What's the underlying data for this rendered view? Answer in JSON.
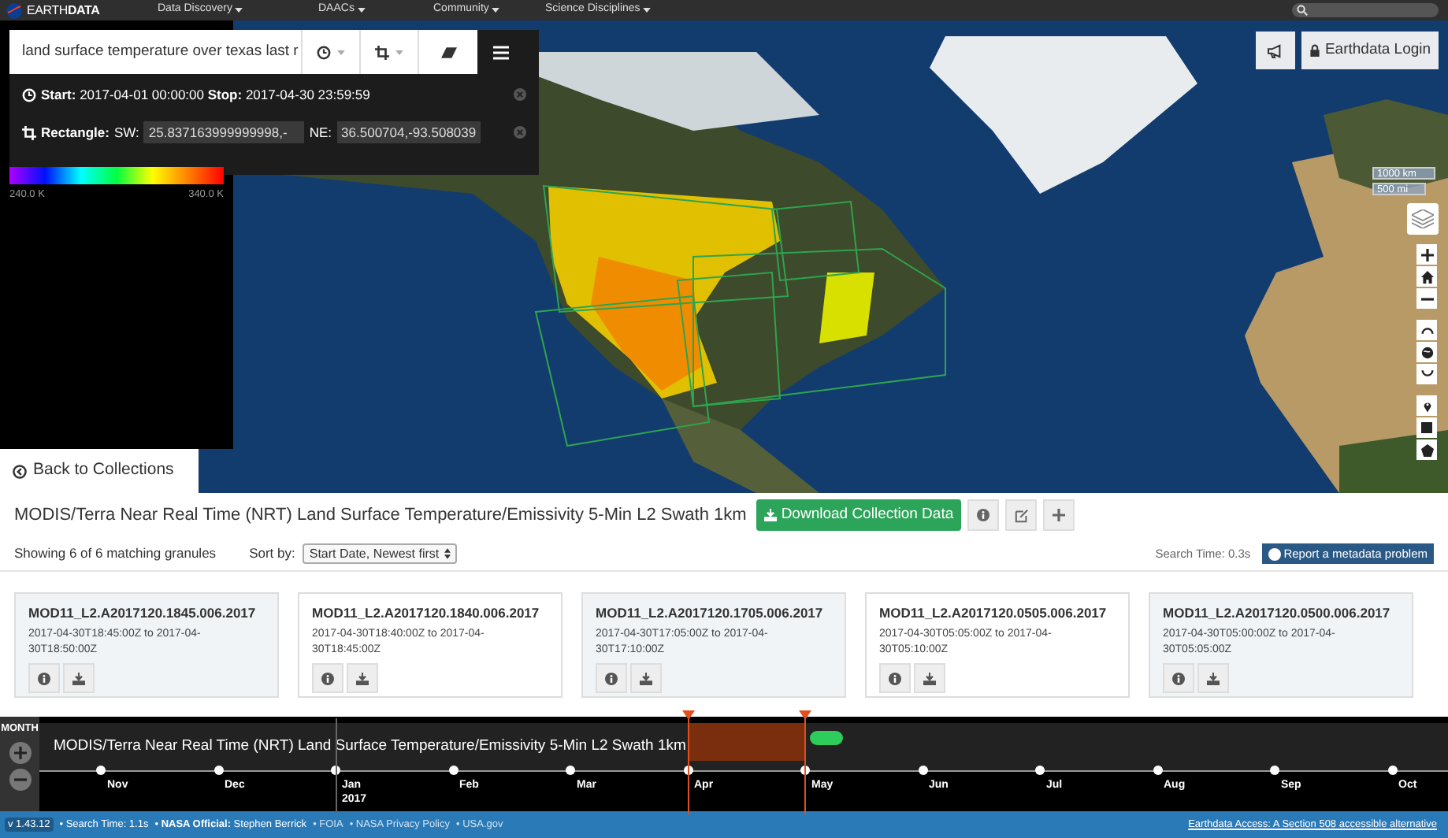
{
  "header": {
    "logo": "EARTH**DATA**",
    "menus": [
      "Data Discovery",
      "DAACs",
      "Community",
      "Science Disciplines"
    ]
  },
  "search_panel": {
    "query": "land surface temperature over texas last r",
    "temporal": "**Start:** 2017-04-01 00:00:00 **Stop:** 2017-04-30 23:59:59",
    "spatial_label": "Rectangle:",
    "sw_label": "SW:",
    "sw": "25.837163999999998,-",
    "ne_label": "NE:",
    "ne": "36.500704,-93.508039"
  },
  "legend": {
    "min": "240.0 K",
    "max": "340.0 K"
  },
  "map_controls": {
    "login": "Earthdata Login",
    "scale": [
      "1000 km",
      "500 mi"
    ]
  },
  "back_button": "Back to Collections",
  "collection": {
    "title": "MODIS/Terra Near Real Time (NRT) Land Surface Temperature/Emissivity 5-Min L2 Swath 1km",
    "download": "Download Collection Data",
    "count": "Showing 6 of 6 matching granules",
    "sort_label": "Sort by:",
    "sort_value": "Start Date, Newest first",
    "search_time": "Search Time: 0.3s",
    "report": "Report a metadata problem"
  },
  "granules": [
    {
      "name": "MOD11_L2.A2017120.1845.006.2017",
      "time": "2017-04-30T18:45:00Z to 2017-04-30T18:50:00Z"
    },
    {
      "name": "MOD11_L2.A2017120.1840.006.2017",
      "time": "2017-04-30T18:40:00Z to 2017-04-30T18:45:00Z"
    },
    {
      "name": "MOD11_L2.A2017120.1705.006.2017",
      "time": "2017-04-30T17:05:00Z to 2017-04-30T17:10:00Z"
    },
    {
      "name": "MOD11_L2.A2017120.0505.006.2017",
      "time": "2017-04-30T05:05:00Z to 2017-04-30T05:10:00Z"
    },
    {
      "name": "MOD11_L2.A2017120.0500.006.2017",
      "time": "2017-04-30T05:00:00Z to 2017-04-30T05:05:00Z"
    }
  ],
  "timeline": {
    "zoom_label": "MONTH",
    "track": "MODIS/Terra Near Real Time (NRT) Land Surface Temperature/Emissivity 5-Min L2 Swath 1km",
    "months": [
      {
        "label": "Nov",
        "marker": false
      },
      {
        "label": "Dec",
        "marker": false
      },
      {
        "label": "Jan",
        "year": "2017",
        "marker": false
      },
      {
        "label": "Feb",
        "marker": false
      },
      {
        "label": "Mar",
        "marker": false
      },
      {
        "label": "Apr",
        "marker": true
      },
      {
        "label": "May",
        "marker": true
      },
      {
        "label": "Jun",
        "marker": false
      },
      {
        "label": "Jul",
        "marker": false
      },
      {
        "label": "Aug",
        "marker": false
      },
      {
        "label": "Sep",
        "marker": false
      },
      {
        "label": "Oct",
        "marker": false
      }
    ]
  },
  "footer": {
    "version": "v 1.43.12",
    "items": [
      "• Search Time: 1.1s",
      "• **NASA Official:** Stephen Berrick"
    ],
    "links": [
      "• FOIA",
      "• NASA Privacy Policy",
      "• USA.gov"
    ],
    "accessibility": "Earthdata Access: A Section 508 accessible alternative"
  }
}
